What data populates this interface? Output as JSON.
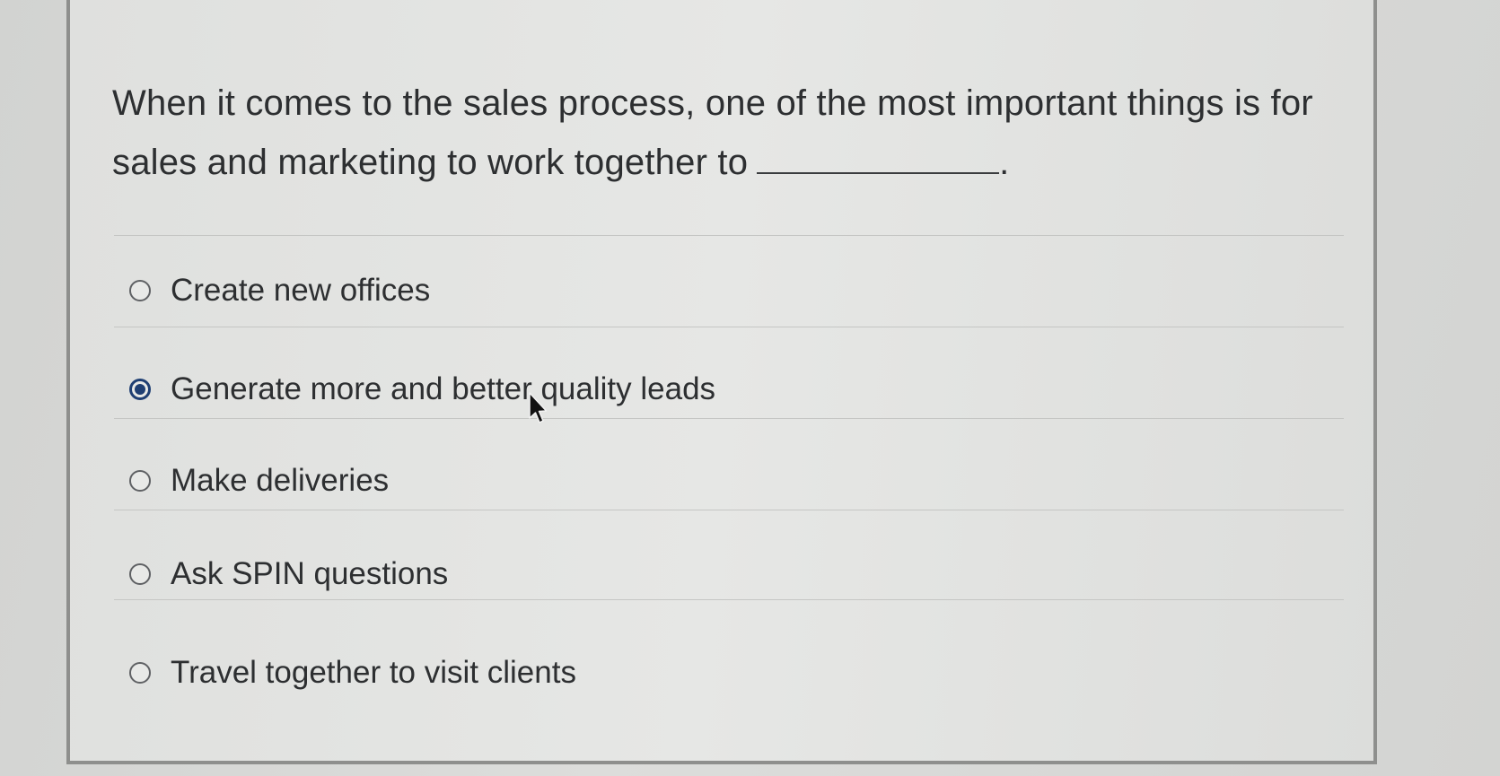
{
  "question": {
    "text": "When it comes to the sales process, one of the most important things is for sales and marketing to work together to",
    "trailing_punctuation": "."
  },
  "options": [
    {
      "label": "Create new offices",
      "selected": false
    },
    {
      "label": "Generate more and better quality leads",
      "selected": true
    },
    {
      "label": "Make deliveries",
      "selected": false
    },
    {
      "label": "Ask SPIN questions",
      "selected": false
    },
    {
      "label": "Travel together to visit clients",
      "selected": false
    }
  ],
  "colors": {
    "selected_radio": "#1f3f73",
    "text": "#2d2f31",
    "divider": "#c5c6c4",
    "card_border": "#8e8f8d"
  },
  "icons": {
    "cursor": "mouse-pointer-icon"
  }
}
